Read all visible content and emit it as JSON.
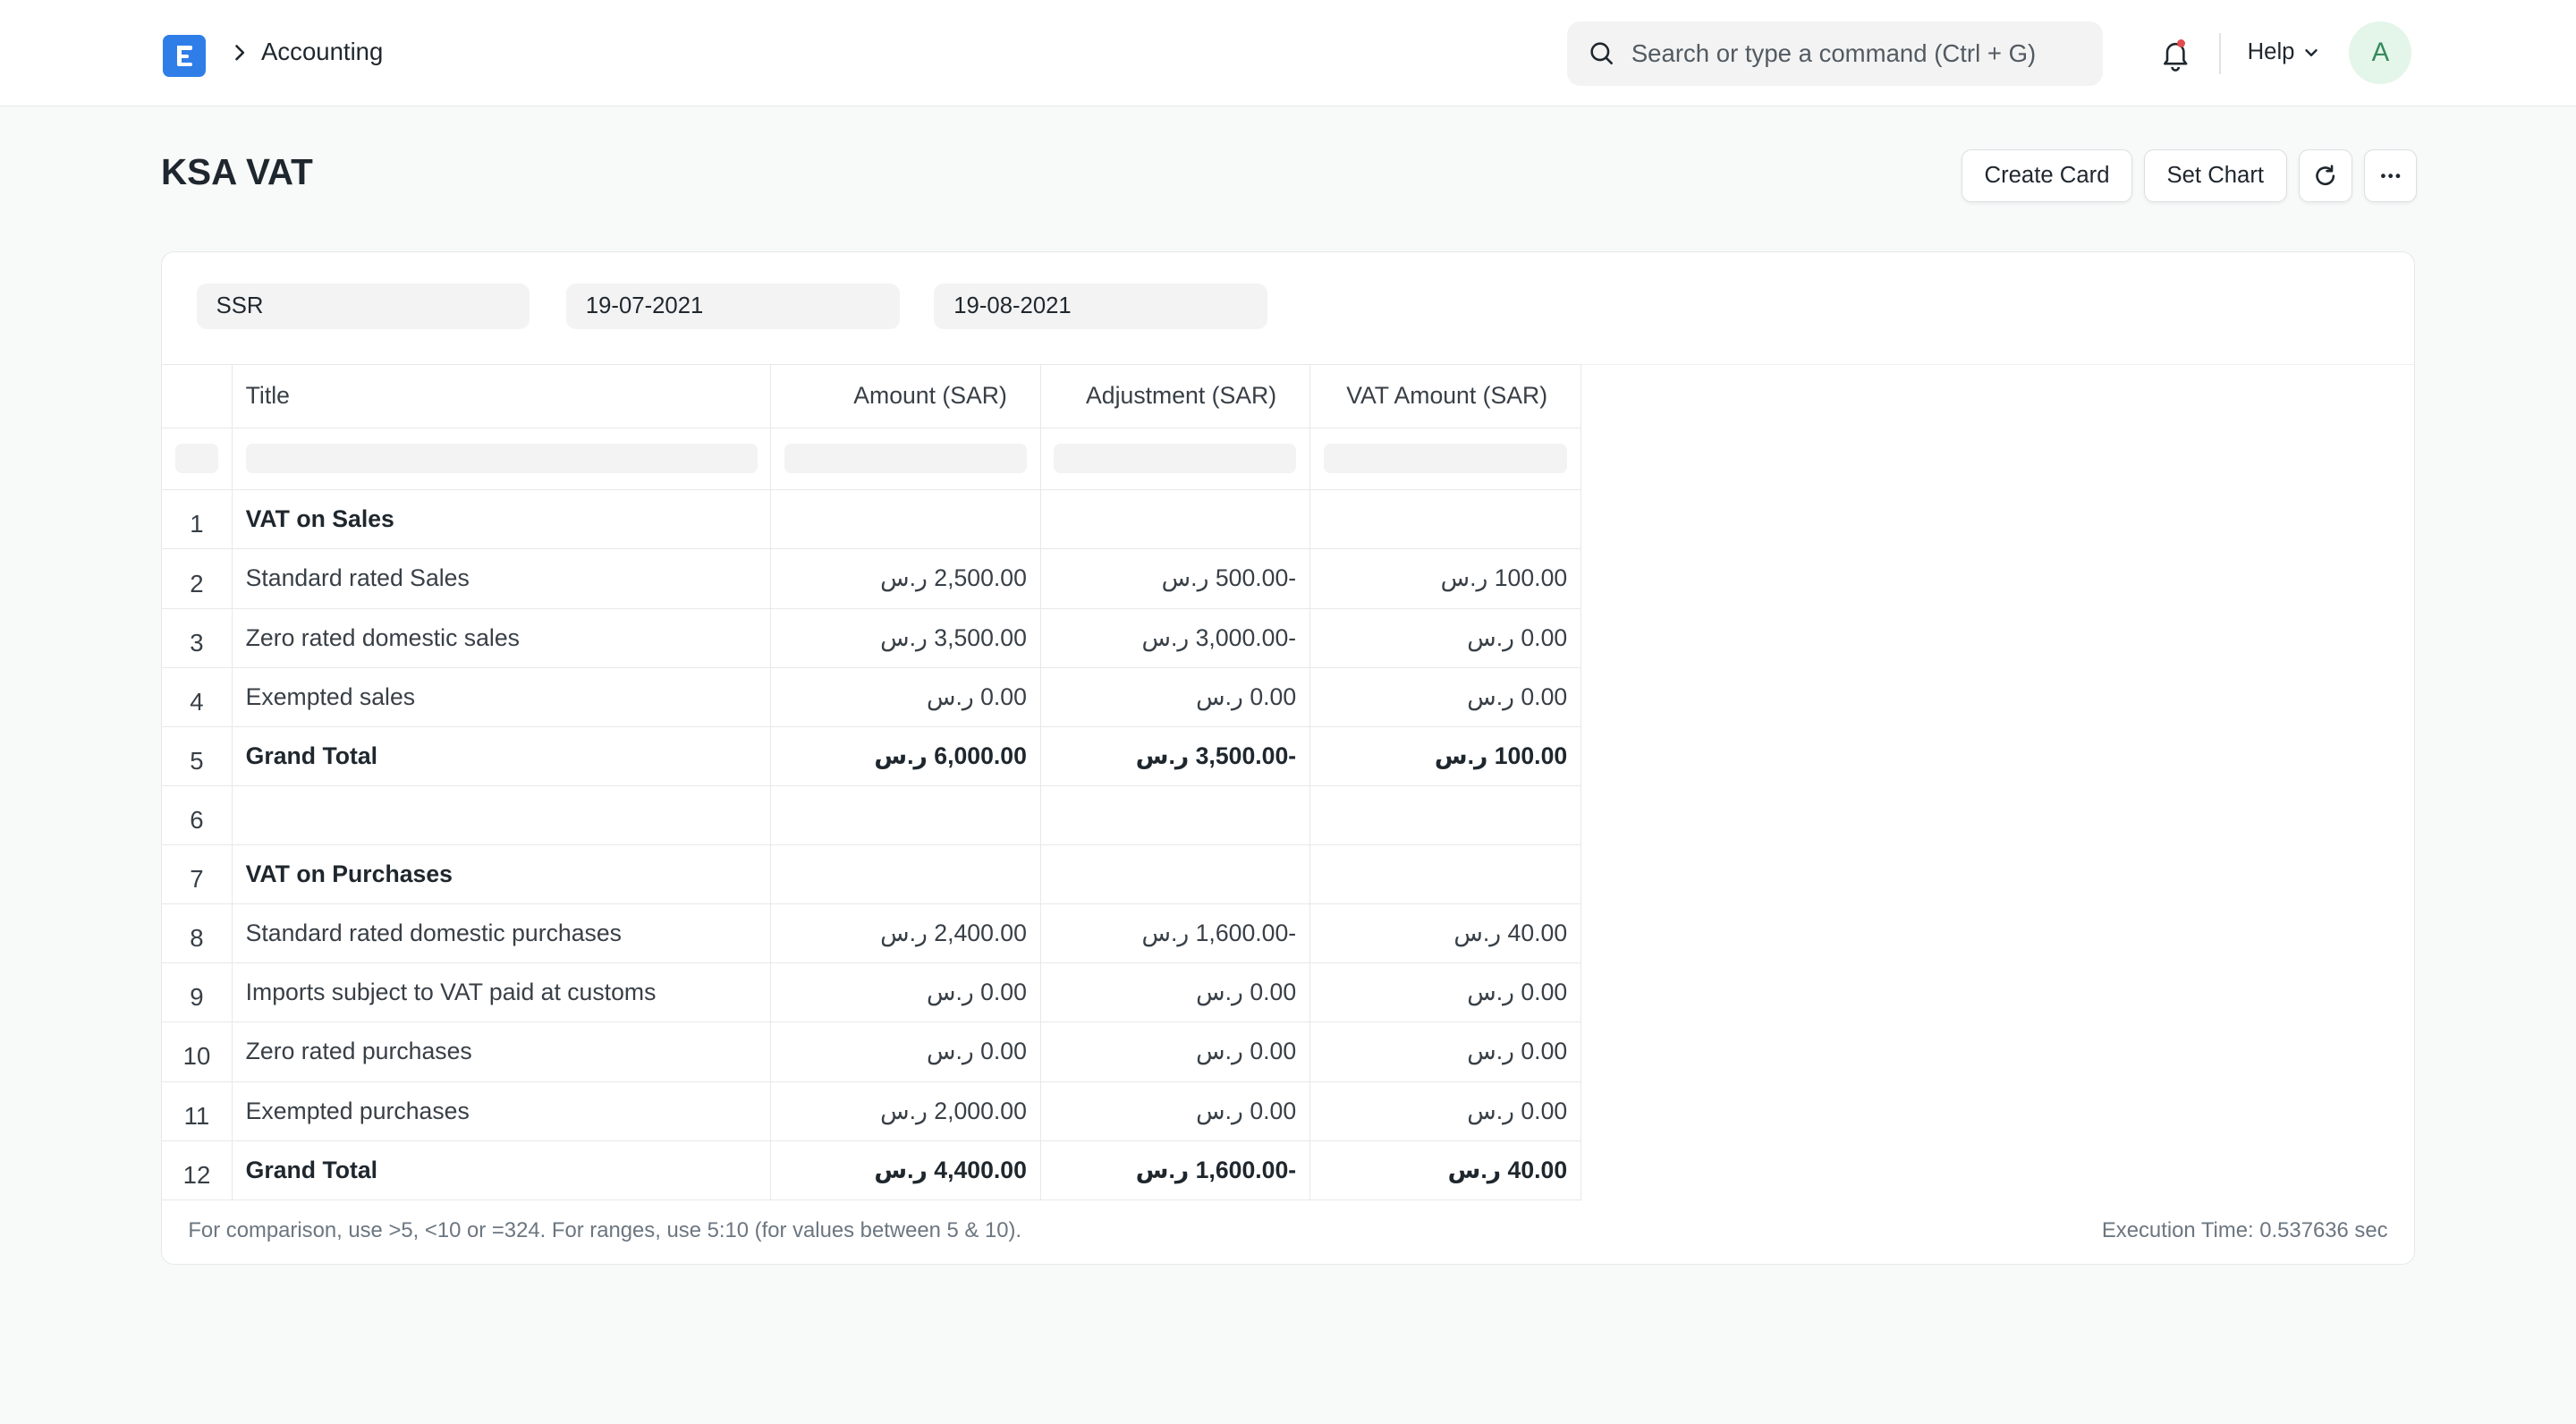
{
  "nav": {
    "breadcrumb": "Accounting",
    "search_placeholder": "Search or type a command (Ctrl + G)",
    "help_label": "Help",
    "avatar_initial": "A"
  },
  "page": {
    "title": "KSA VAT",
    "buttons": {
      "create_card": "Create Card",
      "set_chart": "Set Chart"
    }
  },
  "filters": {
    "company": "SSR",
    "from_date": "19-07-2021",
    "to_date": "19-08-2021"
  },
  "table": {
    "columns": [
      "Title",
      "Amount (SAR)",
      "Adjustment (SAR)",
      "VAT Amount (SAR)"
    ],
    "rows": [
      {
        "n": "1",
        "title": "VAT on Sales",
        "amount": "",
        "adjustment": "",
        "vat": ""
      },
      {
        "n": "2",
        "title": "Standard rated Sales",
        "amount": "2,500.00 ر.س",
        "adjustment": "-500.00 ر.س",
        "vat": "100.00 ر.س"
      },
      {
        "n": "3",
        "title": "Zero rated domestic sales",
        "amount": "3,500.00 ر.س",
        "adjustment": "-3,000.00 ر.س",
        "vat": "0.00 ر.س"
      },
      {
        "n": "4",
        "title": "Exempted sales",
        "amount": "0.00 ر.س",
        "adjustment": "0.00 ر.س",
        "vat": "0.00 ر.س"
      },
      {
        "n": "5",
        "title": "Grand Total",
        "amount": "6,000.00 ر.س",
        "adjustment": "-3,500.00 ر.س",
        "vat": "100.00 ر.س"
      },
      {
        "n": "6",
        "title": "",
        "amount": "",
        "adjustment": "",
        "vat": ""
      },
      {
        "n": "7",
        "title": "VAT on Purchases",
        "amount": "",
        "adjustment": "",
        "vat": ""
      },
      {
        "n": "8",
        "title": "Standard rated domestic purchases",
        "amount": "2,400.00 ر.س",
        "adjustment": "-1,600.00 ر.س",
        "vat": "40.00 ر.س"
      },
      {
        "n": "9",
        "title": "Imports subject to VAT paid at customs",
        "amount": "0.00 ر.س",
        "adjustment": "0.00 ر.س",
        "vat": "0.00 ر.س"
      },
      {
        "n": "10",
        "title": "Zero rated purchases",
        "amount": "0.00 ر.س",
        "adjustment": "0.00 ر.س",
        "vat": "0.00 ر.س"
      },
      {
        "n": "11",
        "title": "Exempted purchases",
        "amount": "2,000.00 ر.س",
        "adjustment": "0.00 ر.س",
        "vat": "0.00 ر.س"
      },
      {
        "n": "12",
        "title": "Grand Total",
        "amount": "4,400.00 ر.س",
        "adjustment": "-1,600.00 ر.س",
        "vat": "40.00 ر.س"
      }
    ]
  },
  "footer": {
    "note": "For comparison, use >5, <10 or =324. For ranges, use 5:10 (for values between 5 & 10).",
    "execution_time": "Execution Time: 0.537636 sec"
  },
  "colors": {
    "brand": "#2f7ee8",
    "avatar_bg": "#e4f5e9",
    "avatar_fg": "#348a5d",
    "notification_dot": "#e24c4c"
  }
}
